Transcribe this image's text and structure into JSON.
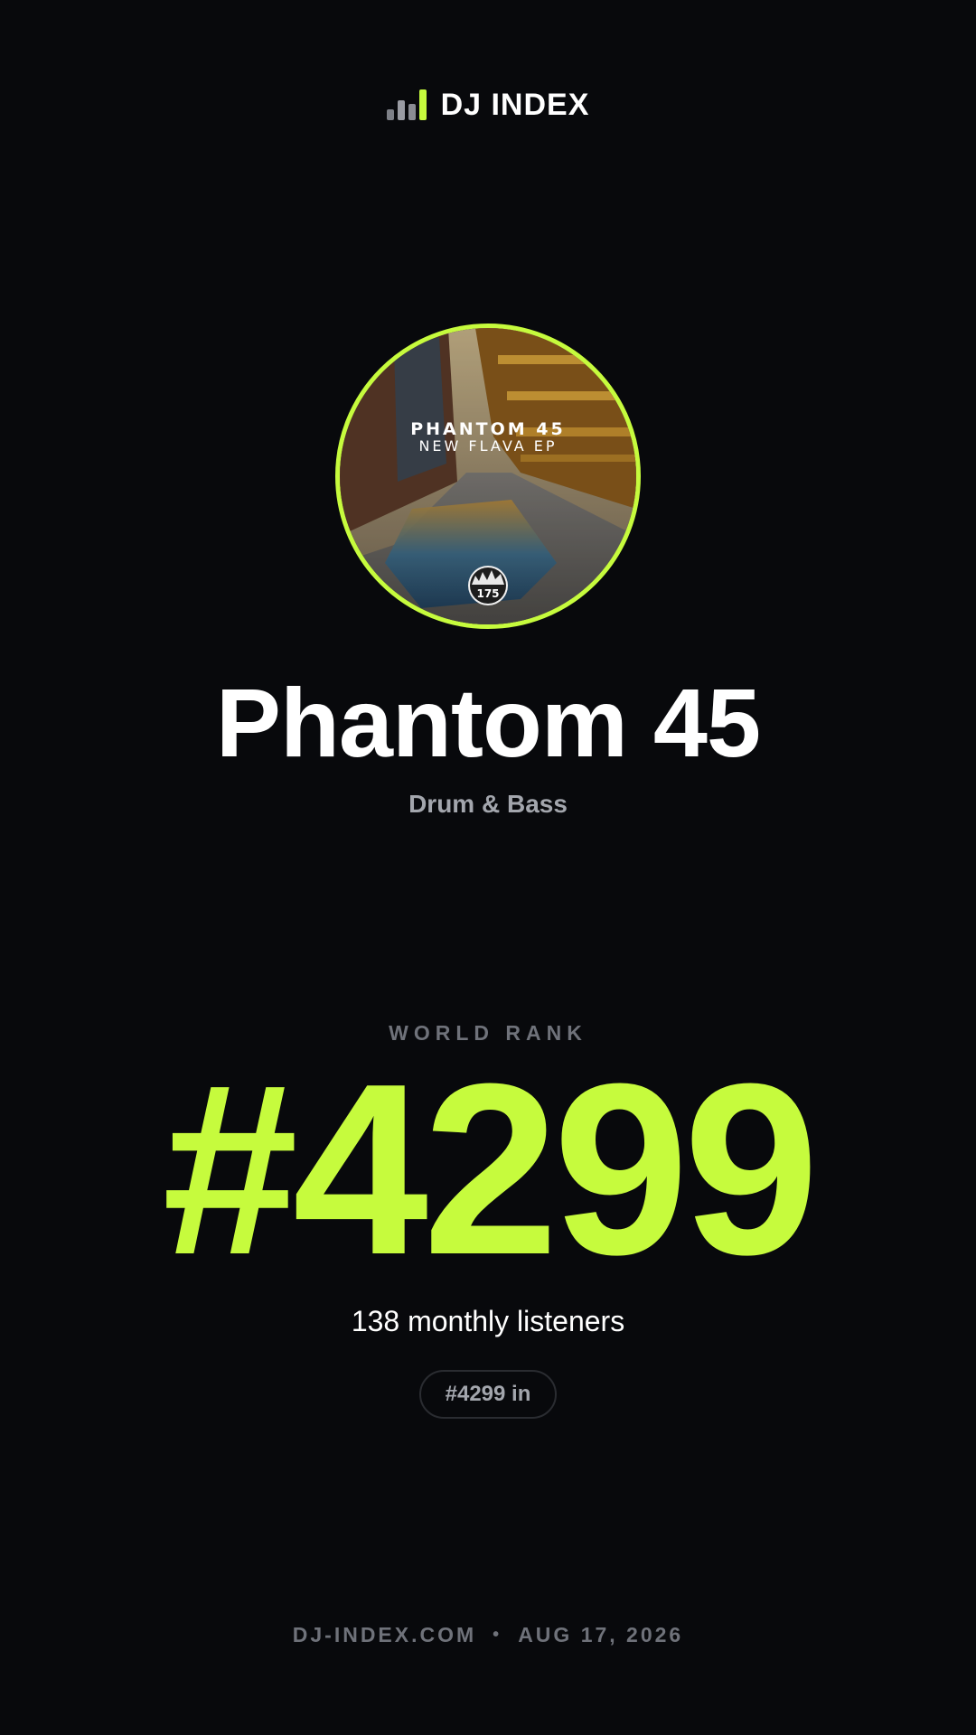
{
  "brand": {
    "icon": "bar-chart-icon",
    "name": "DJ INDEX"
  },
  "artist": {
    "avatar_icon": "album-cover-image",
    "cover_title": "PHANTOM 45",
    "cover_subtitle": "NEW FLAVA EP",
    "cover_badge": "175",
    "name": "Phantom 45",
    "genre": "Drum & Bass"
  },
  "rank": {
    "label": "WORLD RANK",
    "value": "#4299",
    "listeners": "138 monthly listeners",
    "pill": "#4299 in"
  },
  "footer": {
    "site": "DJ-INDEX.COM",
    "separator": "•",
    "date": "AUG 17, 2026"
  },
  "colors": {
    "background": "#08090c",
    "accent": "#c6fb3d",
    "muted": "#6f727a",
    "text": "#ffffff"
  }
}
